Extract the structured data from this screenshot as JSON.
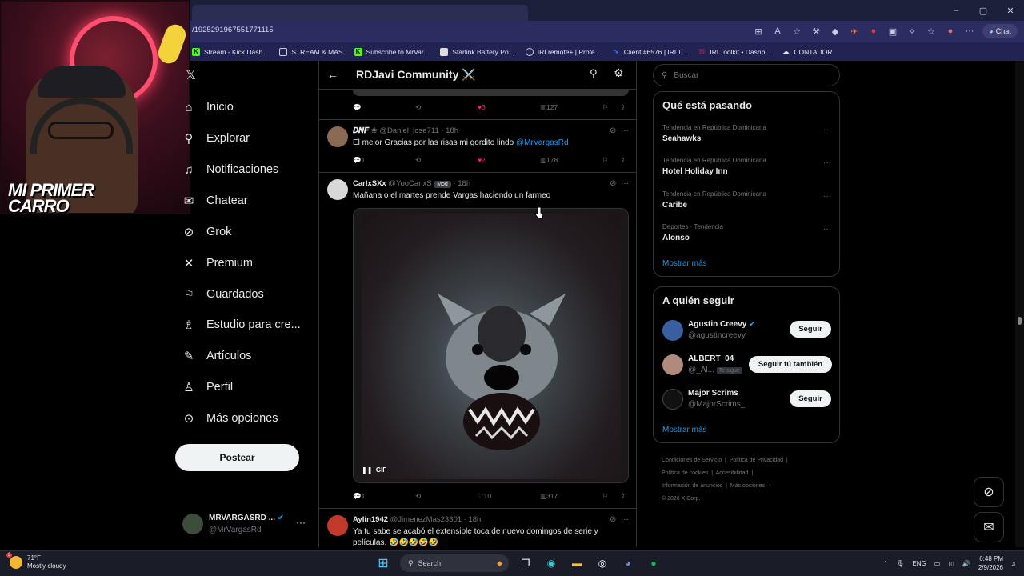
{
  "browser": {
    "url": "/1925291967551771115",
    "window_controls": [
      "–",
      "▢",
      "✕"
    ],
    "chat_label": "Chat",
    "bookmarks": [
      {
        "label": "Stream - Kick Dash...",
        "color": "#53fc18"
      },
      {
        "label": "STREAM & MAS",
        "color": "#cfcfcf"
      },
      {
        "label": "Subscribe to MrVar...",
        "color": "#53fc18"
      },
      {
        "label": "Starlink Battery Po...",
        "color": "#dddddd"
      },
      {
        "label": "IRLremote+ | Profe...",
        "color": "#cfcfcf"
      },
      {
        "label": "Client #6576 | IRLT...",
        "color": "#3d7bff"
      },
      {
        "label": "IRLToolkit • Dashb...",
        "color": "#e0245e"
      },
      {
        "label": "CONTADOR",
        "color": "#cfcfcf"
      }
    ]
  },
  "webcam": {
    "overlay_line1": "MI PRIMER",
    "overlay_line2": "CARRO"
  },
  "nav": {
    "items": [
      {
        "label": "Inicio",
        "icon": "home-icon"
      },
      {
        "label": "Explorar",
        "icon": "search-icon"
      },
      {
        "label": "Notificaciones",
        "icon": "bell-icon"
      },
      {
        "label": "Chatear",
        "icon": "mail-icon"
      },
      {
        "label": "Grok",
        "icon": "grok-icon"
      },
      {
        "label": "Premium",
        "icon": "x-logo-icon"
      },
      {
        "label": "Guardados",
        "icon": "bookmark-icon"
      },
      {
        "label": "Estudio para cre...",
        "icon": "studio-icon"
      },
      {
        "label": "Artículos",
        "icon": "article-icon"
      },
      {
        "label": "Perfil",
        "icon": "person-icon"
      },
      {
        "label": "Más opciones",
        "icon": "more-circle-icon"
      }
    ],
    "post_button": "Postear",
    "profile": {
      "name": "MRVARGASRD ...",
      "handle": "@MrVargasRd"
    }
  },
  "feed": {
    "title": "RDJavi Community ⚔️",
    "top_actions": {
      "likes": "3",
      "views": "127"
    },
    "tweets": [
      {
        "name": "𝑫𝑵𝑭",
        "handle": "@Daniel_jose711 · 18h",
        "text": "El mejor Gracias por las risas mi gordito lindo ",
        "mention": "@MrVargasRd",
        "replies": "1",
        "likes": "2",
        "views": "178",
        "avatar_color": "#8a6a55"
      },
      {
        "name": "CarlxSXx",
        "handle": "@YooCarlxS",
        "badge": "Mod",
        "time": "· 18h",
        "text": "Mañana o el martes prende Vargas haciendo un farmeo",
        "gif_label": "GIF",
        "replies": "1",
        "likes": "10",
        "views": "317",
        "avatar_color": "#d8d8d8"
      },
      {
        "name": "Aylin1942",
        "handle": "@JimenezMas23301 · 18h",
        "text": "Ya tu sabe se acabó el extensible toca de nuevo domingos de serie y películas. 🤣🤣🤣🤣🤣",
        "avatar_color": "#c0392b"
      }
    ]
  },
  "right": {
    "search_placeholder": "Buscar",
    "trending": {
      "title": "Qué está pasando",
      "items": [
        {
          "context": "Tendencia en República Dominicana",
          "name": "Seahawks"
        },
        {
          "context": "Tendencia en República Dominicana",
          "name": "Hotel Holiday Inn"
        },
        {
          "context": "Tendencia en República Dominicana",
          "name": "Caribe"
        },
        {
          "context": "Deportes · Tendencia",
          "name": "Alonso"
        }
      ],
      "show_more": "Mostrar más"
    },
    "who_to_follow": {
      "title": "A quién seguir",
      "items": [
        {
          "name": "Agustin Creevy",
          "handle": "@agustincreevy",
          "button": "Seguir",
          "verified": true,
          "avatar_color": "#3a5fa0"
        },
        {
          "name": "ALBERT_04",
          "handle": "@_Al...",
          "follows_you": "Te sigue",
          "button": "Seguir tú también",
          "avatar_color": "#b08a7a"
        },
        {
          "name": "Major Scrims",
          "handle": "@MajorScrims_",
          "button": "Seguir",
          "avatar_color": "#111111"
        }
      ],
      "show_more": "Mostrar más"
    },
    "footer": [
      "Condiciones de Servicio",
      "Política de Privacidad",
      "Política de cookies",
      "Accesibilidad",
      "Información de anuncios",
      "Más opciones ···",
      "© 2026 X Corp."
    ]
  },
  "taskbar": {
    "weather_temp": "71°F",
    "weather_desc": "Mostly cloudy",
    "weather_badge": "3",
    "search_label": "Search",
    "lang": "ENG",
    "time": "6:48 PM",
    "date": "2/9/2026"
  }
}
